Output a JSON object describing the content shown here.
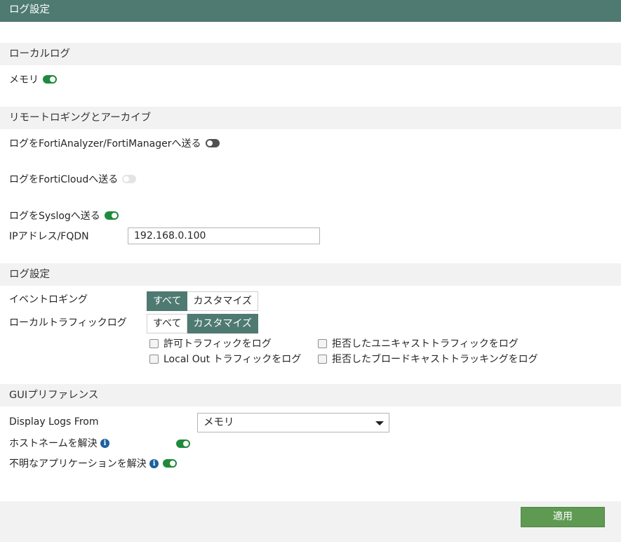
{
  "header": {
    "title": "ログ設定"
  },
  "local_log": {
    "section_title": "ローカルログ",
    "memory_label": "メモリ"
  },
  "remote": {
    "section_title": "リモートロギングとアーカイブ",
    "fortianalyzer_label": "ログをFortiAnalyzer/FortiManagerへ送る",
    "forticloud_label": "ログをFortiCloudへ送る",
    "syslog_label": "ログをSyslogへ送る",
    "ip_label": "IPアドレス/FQDN",
    "ip_value": "192.168.0.100"
  },
  "log_settings": {
    "section_title": "ログ設定",
    "event_logging_label": "イベントロギング",
    "local_traffic_label": "ローカルトラフィックログ",
    "option_all": "すべて",
    "option_custom": "カスタマイズ",
    "checkboxes": {
      "allowed_traffic": "許可トラフィックをログ",
      "local_out_traffic": "Local Out トラフィックをログ",
      "denied_unicast": "拒否したユニキャストトラフィックをログ",
      "denied_broadcast": "拒否したブロードキャストトラッキングをログ"
    }
  },
  "gui_prefs": {
    "section_title": "GUIプリファレンス",
    "display_logs_label": "Display Logs From",
    "display_logs_value": "メモリ",
    "resolve_hostnames_label": "ホストネームを解決",
    "resolve_apps_label": "不明なアプリケーションを解決"
  },
  "footer": {
    "apply_label": "適用"
  },
  "colors": {
    "header_bg": "#4e7a72",
    "toggle_on": "#1f8a3b",
    "toggle_off": "#505050",
    "apply_bg": "#5f9a53",
    "info_icon": "#1e5f9e"
  }
}
